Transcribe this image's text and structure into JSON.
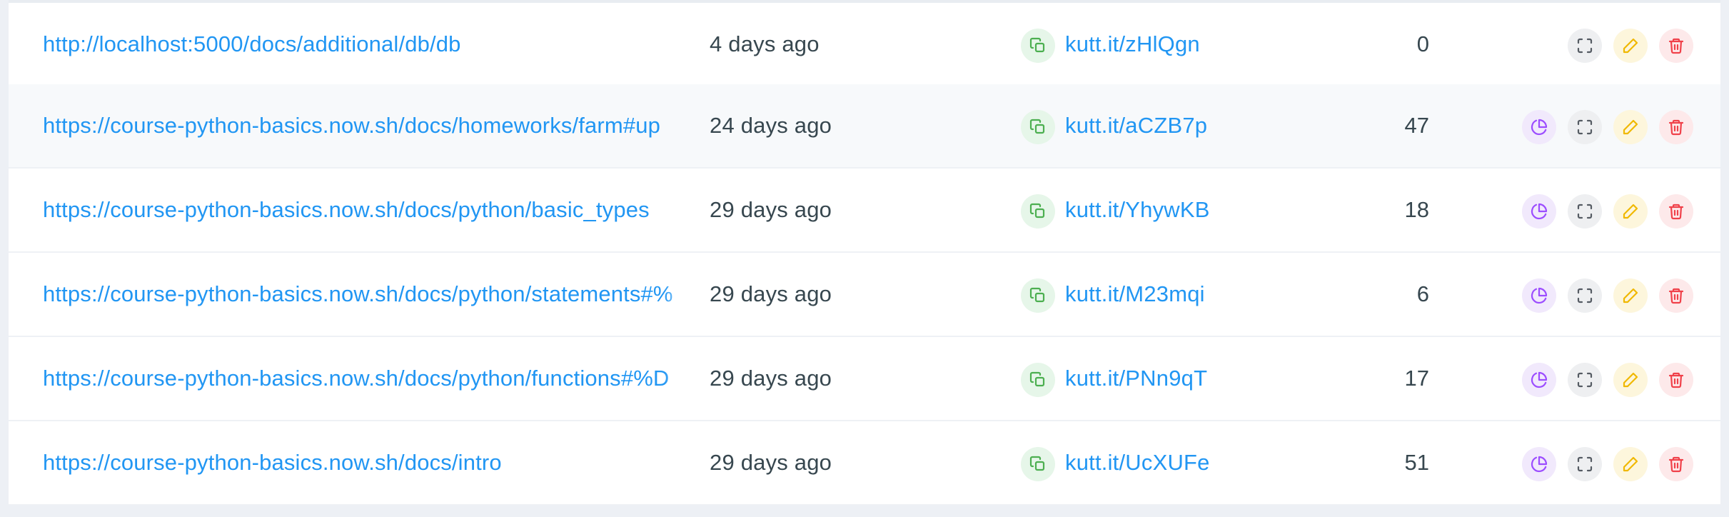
{
  "links": [
    {
      "original_url": "http://localhost:5000/docs/additional/db/db",
      "created": "4 days ago",
      "short_url": "kutt.it/zHlQgn",
      "views": "0",
      "has_stats": false
    },
    {
      "original_url": "https://course-python-basics.now.sh/docs/homeworks/farm#up",
      "created": "24 days ago",
      "short_url": "kutt.it/aCZB7p",
      "views": "47",
      "has_stats": true
    },
    {
      "original_url": "https://course-python-basics.now.sh/docs/python/basic_types",
      "created": "29 days ago",
      "short_url": "kutt.it/YhywKB",
      "views": "18",
      "has_stats": true
    },
    {
      "original_url": "https://course-python-basics.now.sh/docs/python/statements#%",
      "created": "29 days ago",
      "short_url": "kutt.it/M23mqi",
      "views": "6",
      "has_stats": true
    },
    {
      "original_url": "https://course-python-basics.now.sh/docs/python/functions#%D",
      "created": "29 days ago",
      "short_url": "kutt.it/PNn9qT",
      "views": "17",
      "has_stats": true
    },
    {
      "original_url": "https://course-python-basics.now.sh/docs/intro",
      "created": "29 days ago",
      "short_url": "kutt.it/UcXUFe",
      "views": "51",
      "has_stats": true
    }
  ],
  "icons": {
    "copy": "copy-icon",
    "stats": "pie-chart-icon",
    "qr": "qr-frame-icon",
    "edit": "pencil-icon",
    "delete": "trash-icon"
  },
  "colors": {
    "link": "#2196f3",
    "text": "#37474f",
    "copy": "#4caf50",
    "stats": "#9c4dff",
    "qr": "#555b63",
    "edit": "#f0b800",
    "delete": "#f0414a"
  }
}
